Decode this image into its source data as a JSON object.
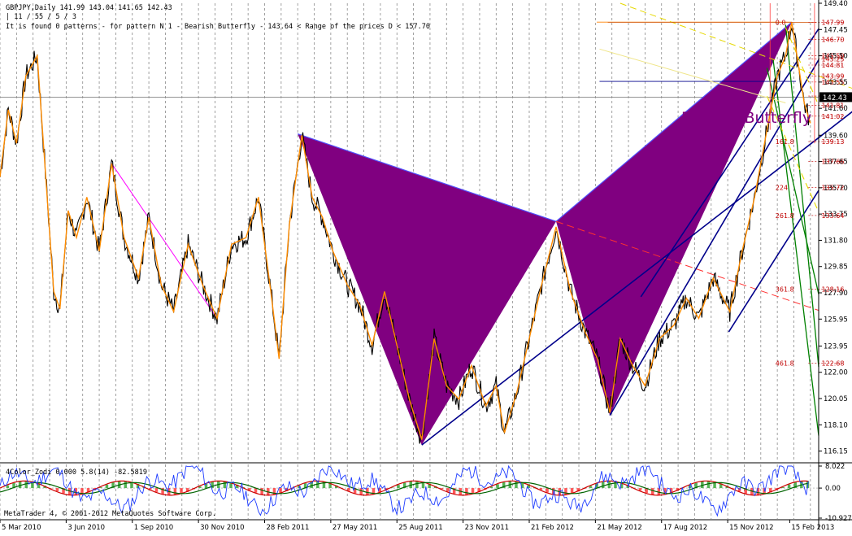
{
  "header": {
    "line1": "GBPJPY,Daily  141.99 143.04 141.65 142.43",
    "line2": "| 11 / 55 / 5 / 3",
    "line3": "It is found 0 patterns  -  for pattern N 1 - Bearish Butterfly  - 143.64 < Range of the prices D < 157.70"
  },
  "pattern_label": "Bearish Butterfly",
  "indicator": {
    "title": "4Color_Zodi 0.000  5.8(14)  -82.5819",
    "axis_labels": [
      "8.022",
      "0.00",
      "-10.927"
    ]
  },
  "copyright": "MetaTrader 4, © 2001-2012 MetaQuotes Software Corp.",
  "current_price": "142.43",
  "colors": {
    "price": "#000000",
    "zigzag": "#ff8c00",
    "pattern_fill": "#800080",
    "channel": "#00008b",
    "green_lines": "#008000",
    "yellow_lines": "#e6d800",
    "red_dashed": "#ff3030",
    "fib_text": "#c00000",
    "pink_line": "#ff00ff",
    "label_color": "#800080"
  },
  "chart_data": {
    "type": "line",
    "title": "GBPJPY,Daily",
    "symbol": "GBPJPY",
    "timeframe": "Daily",
    "ohlc_last": {
      "open": 141.99,
      "high": 143.04,
      "low": 141.65,
      "close": 142.43
    },
    "ylim": [
      115.4,
      149.4
    ],
    "y_ticks": [
      149.4,
      147.45,
      145.5,
      143.55,
      141.6,
      139.6,
      137.65,
      135.7,
      133.75,
      131.8,
      129.85,
      127.9,
      125.95,
      123.95,
      122.0,
      120.05,
      118.1,
      116.15
    ],
    "x_ticks": [
      "5 Mar 2010",
      "3 Jun 2010",
      "1 Sep 2010",
      "30 Nov 2010",
      "28 Feb 2011",
      "27 May 2011",
      "25 Aug 2011",
      "23 Nov 2011",
      "21 Feb 2012",
      "21 May 2012",
      "17 Aug 2012",
      "15 Nov 2012",
      "15 Feb 2013"
    ],
    "x_tick_index": [
      0,
      64,
      128,
      192,
      256,
      320,
      384,
      448,
      512,
      576,
      640,
      704,
      764
    ],
    "n_bars": 792,
    "price_series": [
      {
        "i": 0,
        "y": 136.5
      },
      {
        "i": 8,
        "y": 141.5
      },
      {
        "i": 16,
        "y": 139.0
      },
      {
        "i": 25,
        "y": 144.0
      },
      {
        "i": 36,
        "y": 145.5
      },
      {
        "i": 42,
        "y": 139.0
      },
      {
        "i": 52,
        "y": 128.0
      },
      {
        "i": 58,
        "y": 126.7
      },
      {
        "i": 66,
        "y": 134.0
      },
      {
        "i": 74,
        "y": 132.0
      },
      {
        "i": 84,
        "y": 135.0
      },
      {
        "i": 96,
        "y": 131.0
      },
      {
        "i": 108,
        "y": 137.5
      },
      {
        "i": 120,
        "y": 132.0
      },
      {
        "i": 134,
        "y": 129.0
      },
      {
        "i": 144,
        "y": 133.5
      },
      {
        "i": 156,
        "y": 128.5
      },
      {
        "i": 168,
        "y": 126.5
      },
      {
        "i": 182,
        "y": 131.5
      },
      {
        "i": 196,
        "y": 128.5
      },
      {
        "i": 210,
        "y": 126.0
      },
      {
        "i": 224,
        "y": 131.5
      },
      {
        "i": 238,
        "y": 132.0
      },
      {
        "i": 250,
        "y": 135.0
      },
      {
        "i": 262,
        "y": 128.0
      },
      {
        "i": 270,
        "y": 123.0
      },
      {
        "i": 280,
        "y": 133.0
      },
      {
        "i": 292,
        "y": 139.6
      },
      {
        "i": 302,
        "y": 135.0
      },
      {
        "i": 312,
        "y": 133.5
      },
      {
        "i": 322,
        "y": 131.0
      },
      {
        "i": 336,
        "y": 128.5
      },
      {
        "i": 348,
        "y": 127.0
      },
      {
        "i": 360,
        "y": 124.0
      },
      {
        "i": 372,
        "y": 128.0
      },
      {
        "i": 384,
        "y": 124.0
      },
      {
        "i": 396,
        "y": 120.0
      },
      {
        "i": 408,
        "y": 117.0
      },
      {
        "i": 420,
        "y": 124.5
      },
      {
        "i": 432,
        "y": 121.0
      },
      {
        "i": 444,
        "y": 120.0
      },
      {
        "i": 456,
        "y": 122.5
      },
      {
        "i": 470,
        "y": 119.5
      },
      {
        "i": 480,
        "y": 121.0
      },
      {
        "i": 488,
        "y": 117.5
      },
      {
        "i": 500,
        "y": 120.5
      },
      {
        "i": 512,
        "y": 124.5
      },
      {
        "i": 524,
        "y": 128.5
      },
      {
        "i": 538,
        "y": 132.8
      },
      {
        "i": 552,
        "y": 128.0
      },
      {
        "i": 566,
        "y": 125.0
      },
      {
        "i": 578,
        "y": 123.0
      },
      {
        "i": 590,
        "y": 119.0
      },
      {
        "i": 600,
        "y": 124.5
      },
      {
        "i": 612,
        "y": 122.5
      },
      {
        "i": 624,
        "y": 121.0
      },
      {
        "i": 638,
        "y": 124.5
      },
      {
        "i": 652,
        "y": 125.5
      },
      {
        "i": 664,
        "y": 127.5
      },
      {
        "i": 676,
        "y": 126.0
      },
      {
        "i": 690,
        "y": 129.0
      },
      {
        "i": 706,
        "y": 126.5
      },
      {
        "i": 718,
        "y": 131.0
      },
      {
        "i": 730,
        "y": 135.0
      },
      {
        "i": 742,
        "y": 140.0
      },
      {
        "i": 752,
        "y": 144.0
      },
      {
        "i": 760,
        "y": 145.5
      },
      {
        "i": 766,
        "y": 148.0
      },
      {
        "i": 772,
        "y": 145.0
      },
      {
        "i": 778,
        "y": 142.0
      },
      {
        "i": 784,
        "y": 140.5
      }
    ],
    "butterfly_patterns": [
      {
        "name": "pattern-1",
        "X": {
          "i": 288,
          "y": 139.7
        },
        "A": {
          "i": 408,
          "y": 116.6
        },
        "B": {
          "i": 538,
          "y": 133.2
        },
        "C": {
          "i": 590,
          "y": 118.8
        },
        "D": {
          "i": 766,
          "y": 148.0
        }
      }
    ],
    "fibonacci_levels": [
      {
        "level": "0.0",
        "price": "147.99"
      },
      {
        "level": "",
        "price": "146.70"
      },
      {
        "level": "",
        "price": "145.50"
      },
      {
        "level": "",
        "price": "145.25"
      },
      {
        "level": "",
        "price": "144.81"
      },
      {
        "level": "",
        "price": "143.99"
      },
      {
        "level": "",
        "price": "143.55"
      },
      {
        "level": "",
        "price": "142.51"
      },
      {
        "level": "",
        "price": "141.81"
      },
      {
        "level": "",
        "price": "141.02"
      },
      {
        "level": "161.8",
        "price": "139.13"
      },
      {
        "level": "",
        "price": "137.66"
      },
      {
        "level": "224",
        "price": "135.72"
      },
      {
        "level": "261.8",
        "price": "133.64"
      },
      {
        "level": "361.8",
        "price": "128.16"
      },
      {
        "level": "461.8",
        "price": "122.68"
      }
    ],
    "indicator_ylim": [
      -10.927,
      8.022
    ],
    "grid": true
  }
}
